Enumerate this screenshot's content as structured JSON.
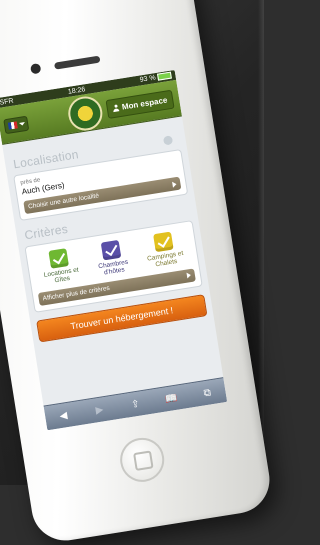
{
  "statusbar": {
    "carrier": "SFR",
    "time": "18:26",
    "battery": "93 %"
  },
  "header": {
    "account_button": "Mon espace"
  },
  "location": {
    "section_title": "Localisation",
    "near_label": "près de",
    "locality": "Auch (Gers)",
    "change_link": "Choisir une autre localité"
  },
  "criteria": {
    "section_title": "Critères",
    "items": [
      {
        "label": "Locations et Gîtes",
        "color": "#6fb832"
      },
      {
        "label": "Chambres d'hôtes",
        "color": "#5a4fa8"
      },
      {
        "label": "Campings et Chalets",
        "color": "#e2c11f"
      }
    ],
    "more_link": "Afficher plus de critères"
  },
  "cta": {
    "label": "Trouver un hébergement !"
  },
  "browser": {
    "back": "◀",
    "forward": "▶",
    "share": "⇪",
    "bookmarks": "📖",
    "tabs": "⧉"
  }
}
